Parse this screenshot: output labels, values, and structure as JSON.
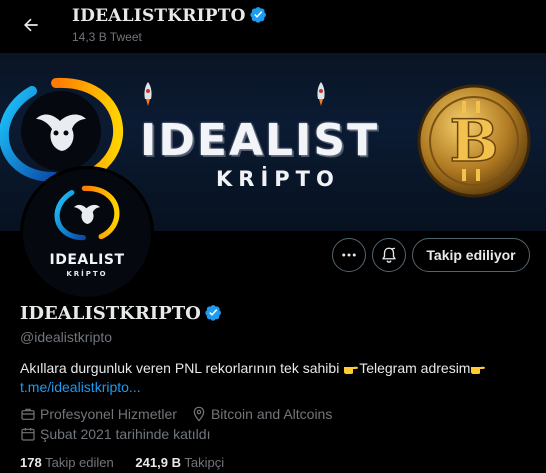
{
  "header": {
    "title": "IDEALISTKRIPTO",
    "tweet_count": "14,3 B Tweet"
  },
  "banner": {
    "title": "IDEALIST",
    "subtitle": "KRİPTO"
  },
  "avatar": {
    "title": "IDEALIST",
    "subtitle": "KRİPTO"
  },
  "actions": {
    "follow_label": "Takip ediliyor"
  },
  "profile": {
    "name": "IDEALISTKRIPTO",
    "handle": "@idealistkripto",
    "bio_text": "Akıllara durgunluk veren PNL rekorlarının tek sahibi ",
    "bio_text2": "Telegram adresim",
    "bio_link": "t.me/idealistkripto...",
    "category": "Profesyonel Hizmetler",
    "location": "Bitcoin and Altcoins",
    "joined": "Şubat 2021 tarihinde katıldı",
    "following_count": "178",
    "following_label": "Takip edilen",
    "followers_count": "241,9 B",
    "followers_label": "Takipçi"
  },
  "colors": {
    "background": "#000000",
    "text": "#e7e9ea",
    "muted": "#71767b",
    "link": "#1d9bf0",
    "verified": "#1d9bf0"
  },
  "icons": [
    "arrow-left-icon",
    "verified-badge-icon",
    "more-icon",
    "notification-bell-icon",
    "briefcase-icon",
    "location-pin-icon",
    "calendar-icon",
    "backhand-point-right-emoji"
  ]
}
